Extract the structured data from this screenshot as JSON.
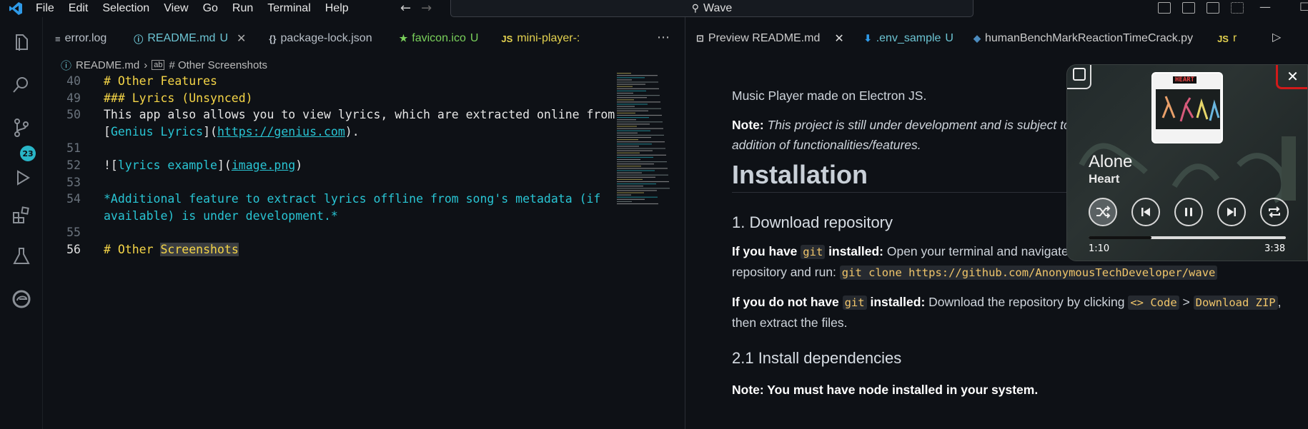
{
  "menu": [
    "File",
    "Edit",
    "Selection",
    "View",
    "Go",
    "Run",
    "Terminal",
    "Help"
  ],
  "search": {
    "text": "Wave"
  },
  "scm_badge": "23",
  "editor_tabs": [
    {
      "icon": "≡",
      "label": "error.log",
      "suffix": "",
      "color": "#b8bfc7"
    },
    {
      "icon": "ⓘ",
      "label": "README.md",
      "suffix": "U",
      "color": "#6cc4d3"
    },
    {
      "icon": "{}",
      "label": "package-lock.json",
      "suffix": "",
      "color": "#b8bfc7"
    },
    {
      "icon": "★",
      "label": "favicon.ico",
      "suffix": "U",
      "color": "#7ad15b"
    },
    {
      "icon": "JS",
      "label": "mini-player-:",
      "suffix": "",
      "color": "#e4d24f"
    }
  ],
  "breadcrumb": {
    "file": "README.md",
    "section": "# Other Screenshots"
  },
  "code_lines": [
    {
      "n": "40",
      "t": "# Other Features"
    },
    {
      "n": "49",
      "t": "### Lyrics (Unsynced)"
    },
    {
      "n": "50",
      "t": "This app also allows you to view lyrics, which are extracted online from"
    },
    {
      "n": "",
      "t": "[Genius Lyrics](https://genius.com)."
    },
    {
      "n": "51",
      "t": ""
    },
    {
      "n": "52",
      "t": "![lyrics example](image.png)"
    },
    {
      "n": "53",
      "t": ""
    },
    {
      "n": "54",
      "t": "*Additional feature to extract lyrics offline from song's metadata (if"
    },
    {
      "n": "",
      "t": "available) is under development.*"
    },
    {
      "n": "55",
      "t": ""
    },
    {
      "n": "56",
      "t": "# Other Screenshots"
    }
  ],
  "parts": {
    "l50b_link_text": "Genius Lyrics",
    "l50b_url": "https://genius.com",
    "l52_alt": "lyrics example",
    "l52_src": "image.png",
    "l56_hash": "# Other ",
    "l56_word": "Screenshots"
  },
  "preview_tabs": [
    {
      "label": "Preview README.md",
      "suffix": ""
    },
    {
      "label": ".env_sample",
      "suffix": "U"
    },
    {
      "label": "humanBenchMarkReactionTimeCrack.py",
      "suffix": ""
    },
    {
      "label": "r",
      "suffix": ""
    }
  ],
  "doc": {
    "intro": "Music Player made on Electron JS.",
    "note_label": "Note:",
    "note_text": "This project is still under development and is subject to multiple changes or change in UI and addition of functionalities/features.",
    "h_install": "Installation",
    "h_download": "1. Download repository",
    "git_label_a": "If you have ",
    "git_code": "git",
    "git_label_b": " installed:",
    "git_text": "Open your terminal and navigate to the location you want to download the repository and run:",
    "git_cmd": "git clone https://github.com/AnonymousTechDeveloper/wave",
    "nogit_label_a": "If you do not have ",
    "nogit_label_b": " installed:",
    "nogit_text": "Download the repository by clicking",
    "code_btn": "<> Code",
    "gt": ">",
    "zip_btn": "Download ZIP",
    "nogit_tail": ", then extract the files.",
    "h_deps": "2.1 Install dependencies",
    "node_note": "Note: You must have node installed in your system."
  },
  "player": {
    "song": "Alone",
    "artist": "Heart",
    "elapsed": "1:10",
    "duration": "3:38",
    "progress": 0.32,
    "art_text": "HEART"
  }
}
